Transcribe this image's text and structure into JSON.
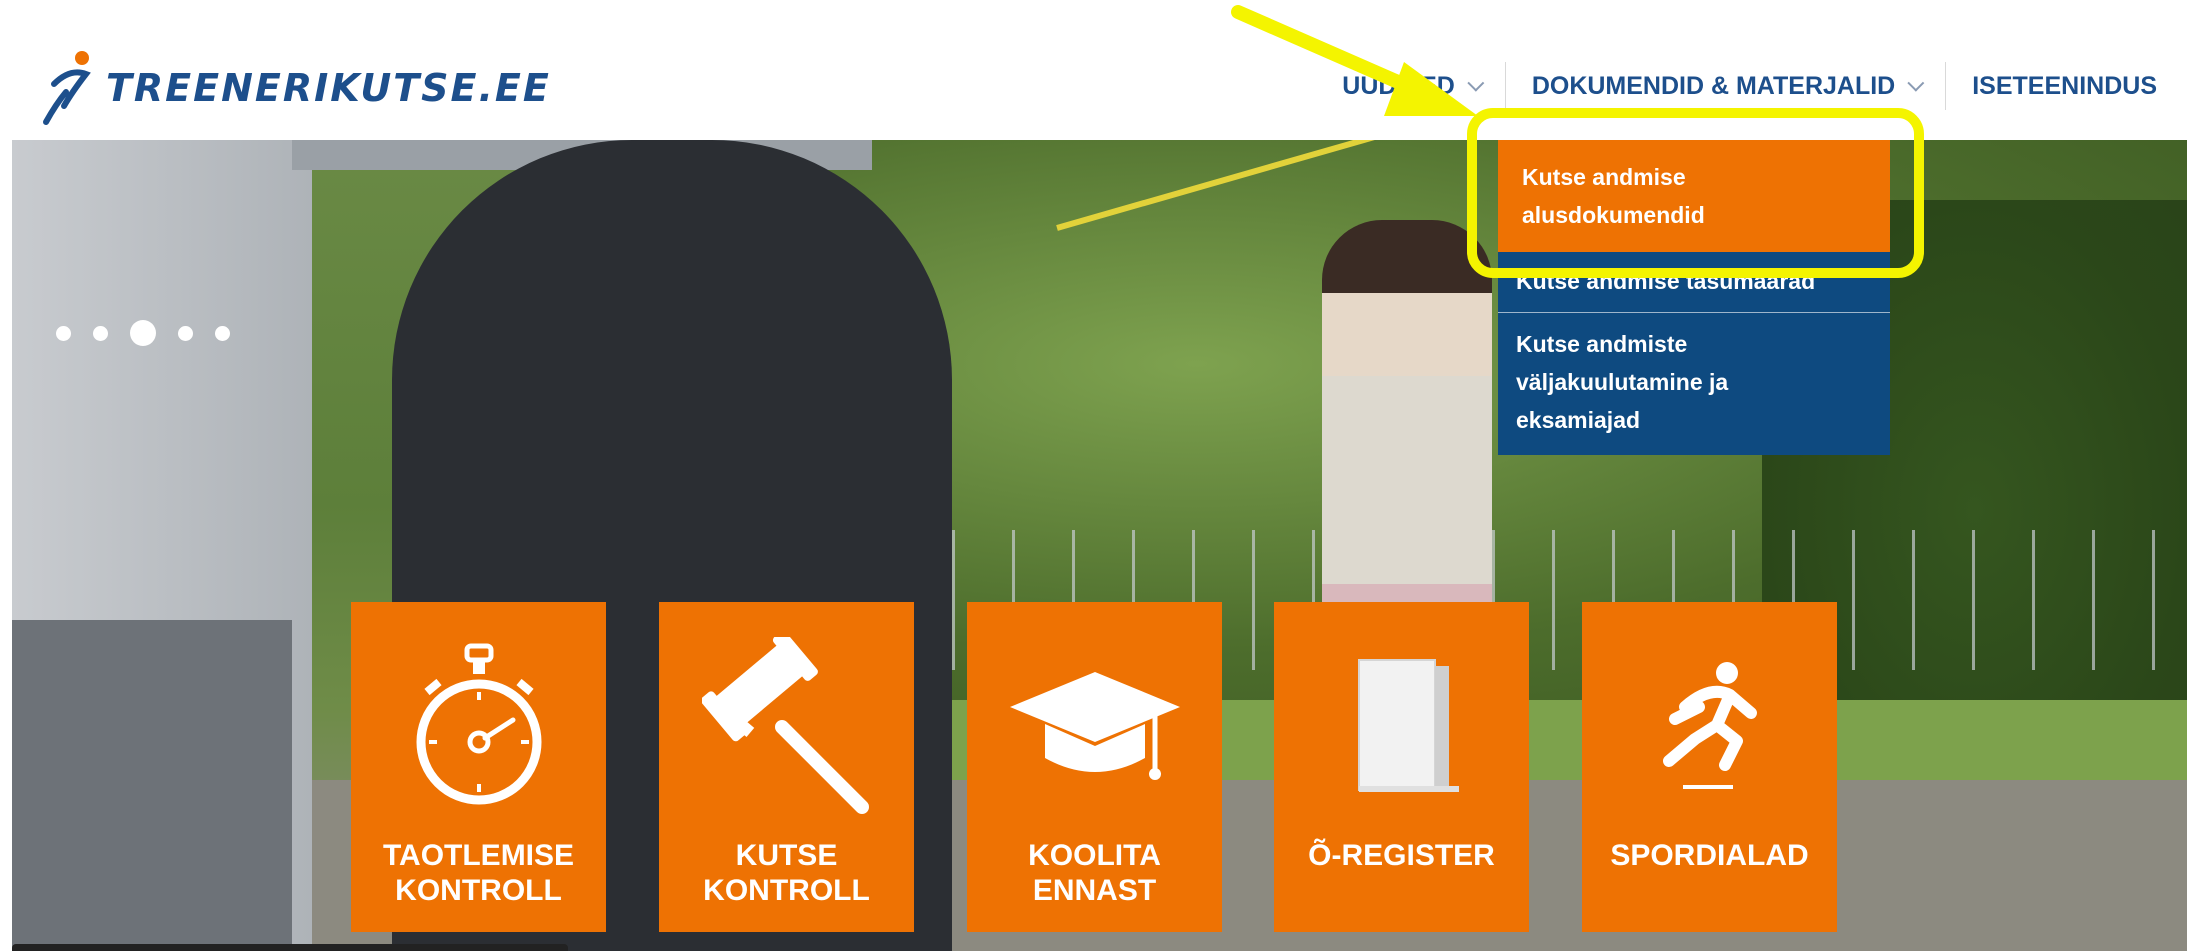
{
  "brand": {
    "logo_text": "TREENERIKUTSE.EE",
    "logo_icon": "runner-logo-icon",
    "color": "#1d4f8c"
  },
  "nav": {
    "items": [
      {
        "label": "UUDISED",
        "has_dropdown": true
      },
      {
        "label": "DOKUMENDID & MATERJALID",
        "has_dropdown": true
      },
      {
        "label": "ISETEENINDUS",
        "has_dropdown": false
      }
    ]
  },
  "dropdown": {
    "items": [
      {
        "label": "Kutse andmise alusdokumendid",
        "state": "hover",
        "color": "#ee7203"
      },
      {
        "label": "Kutse andmise tasumäärad",
        "color": "#0e4a80"
      },
      {
        "label": "Kutse andmiste väljakuulutamine ja eksamiajad",
        "color": "#0e4a80"
      }
    ]
  },
  "slider": {
    "slide_count": 5,
    "active_index": 2
  },
  "tiles": [
    {
      "label_line1": "TAOTLEMISE",
      "label_line2": "KONTROLL",
      "icon": "stopwatch-icon"
    },
    {
      "label_line1": "KUTSE",
      "label_line2": "KONTROLL",
      "icon": "gavel-icon"
    },
    {
      "label_line1": "KOOLITA",
      "label_line2": "ENNAST",
      "icon": "graduation-cap-icon"
    },
    {
      "label_line1": "Õ-REGISTER",
      "label_line2": "",
      "icon": "book-icon"
    },
    {
      "label_line1": "SPORDIALAD",
      "label_line2": "",
      "icon": "runner-icon"
    }
  ],
  "colors": {
    "accent_orange": "#ee7203",
    "navy": "#0e4a80",
    "annotation_yellow": "#f4f400"
  }
}
